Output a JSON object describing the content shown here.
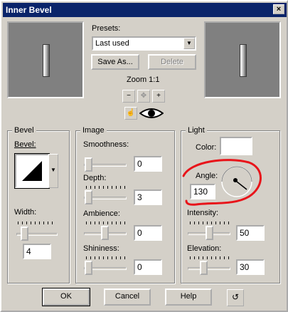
{
  "window": {
    "title": "Inner Bevel",
    "close_label": "×"
  },
  "presets": {
    "label": "Presets:",
    "value": "Last used",
    "save_as": "Save As...",
    "delete": "Delete"
  },
  "zoom": {
    "label": "Zoom 1:1"
  },
  "bevel": {
    "group": "Bevel",
    "bevel_label": "Bevel:",
    "width_label": "Width:",
    "width_value": "4"
  },
  "image": {
    "group": "Image",
    "smoothness_label": "Smoothness:",
    "smoothness_value": "0",
    "depth_label": "Depth:",
    "depth_value": "3",
    "ambience_label": "Ambience:",
    "ambience_value": "0",
    "shininess_label": "Shininess:",
    "shininess_value": "0"
  },
  "light": {
    "group": "Light",
    "color_label": "Color:",
    "color": "#ffffff",
    "angle_label": "Angle:",
    "angle_value": "130",
    "intensity_label": "Intensity:",
    "intensity_value": "50",
    "elevation_label": "Elevation:",
    "elevation_value": "30"
  },
  "buttons": {
    "ok": "OK",
    "cancel": "Cancel",
    "help": "Help"
  },
  "annotation": {
    "color": "#e8141a"
  }
}
